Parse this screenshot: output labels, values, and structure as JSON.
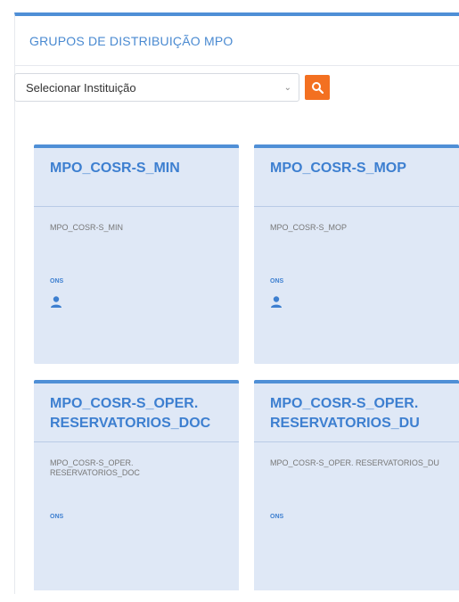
{
  "panel": {
    "title": "GRUPOS DE DISTRIBUIÇÃO MPO"
  },
  "filter": {
    "select_value": "Selecionar Instituição",
    "search_icon": "search-icon"
  },
  "cards": [
    {
      "title": "MPO_COSR-S_MIN",
      "description": "MPO_COSR-S_MIN",
      "org": "ONS",
      "icon": "user-icon"
    },
    {
      "title": "MPO_COSR-S_MOP",
      "description": "MPO_COSR-S_MOP",
      "org": "ONS",
      "icon": "user-icon"
    },
    {
      "title": "MPO_COSR-S_OPER. RESERVATORIOS_DOC",
      "description": "MPO_COSR-S_OPER. RESERVATORIOS_DOC",
      "org": "ONS"
    },
    {
      "title": "MPO_COSR-S_OPER. RESERVATORIOS_DU",
      "description": "MPO_COSR-S_OPER. RESERVATORIOS_DU",
      "org": "ONS"
    }
  ],
  "colors": {
    "accent": "#4f8fd6",
    "card_bg": "#dfe8f6",
    "search_button": "#f37021"
  }
}
